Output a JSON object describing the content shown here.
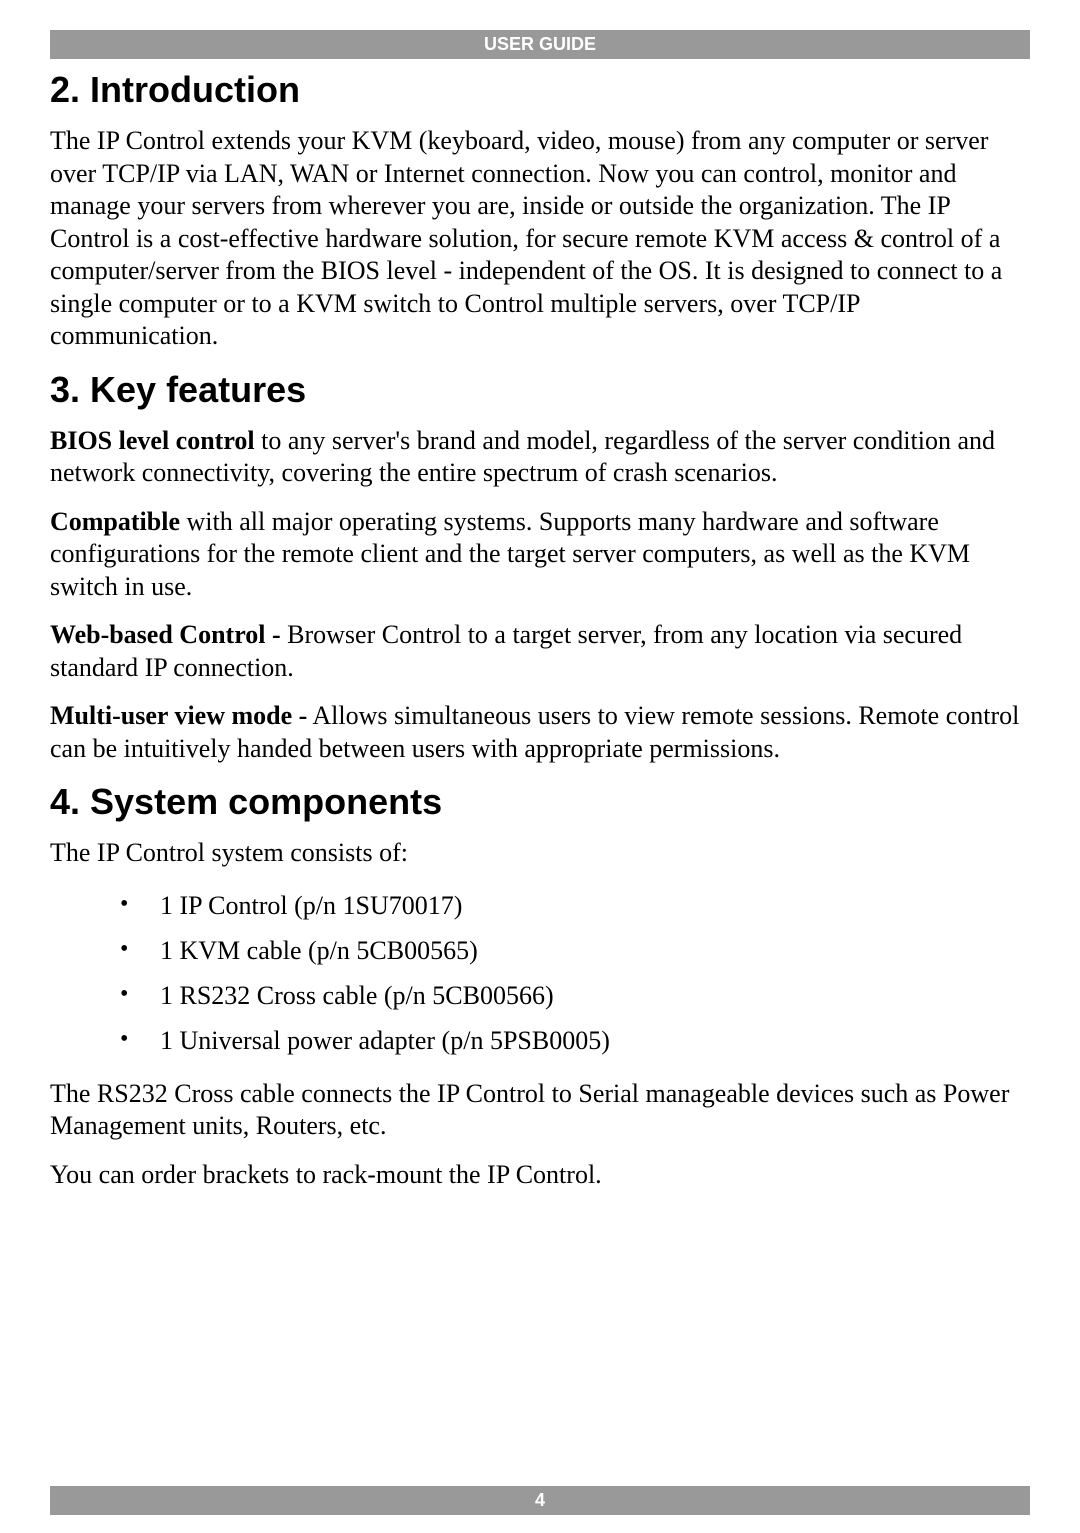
{
  "header": {
    "label": "USER GUIDE"
  },
  "sections": {
    "introduction": {
      "heading": "2. Introduction",
      "body": "The IP Control extends your KVM (keyboard, video, mouse) from any computer or server over TCP/IP via LAN, WAN or Internet connection. Now you can control, monitor and manage your servers from wherever you are, inside or outside the organization. The IP Control is a cost-effective hardware solution, for secure remote KVM access & control of a computer/server from the BIOS level - independent of the OS. It is designed to connect to a single computer or to a KVM switch to Control multiple servers, over TCP/IP communication."
    },
    "key_features": {
      "heading": "3. Key features",
      "features": [
        {
          "lead": "BIOS level control",
          "rest": " to any server's brand and model, regardless of the server condition and network connectivity, covering the entire spectrum of crash scenarios."
        },
        {
          "lead": "Compatible",
          "rest": " with all major operating systems. Supports many hardware and software configurations for the remote client and the target server computers, as well as the KVM switch in use."
        },
        {
          "lead": "Web-based Control -",
          "rest": " Browser Control to a target server, from any location via secured standard IP connection."
        },
        {
          "lead": "Multi-user view mode -",
          "rest": " Allows simultaneous users to view remote sessions. Remote control can be intuitively handed between users with appropriate permissions."
        }
      ]
    },
    "system_components": {
      "heading": "4. System components",
      "intro": "The IP Control system consists of:",
      "items": [
        "1 IP Control (p/n 1SU70017)",
        "1 KVM cable (p/n 5CB00565)",
        "1 RS232 Cross cable (p/n 5CB00566)",
        "1 Universal power adapter (p/n 5PSB0005)"
      ],
      "after1": "The RS232 Cross cable connects the IP Control to Serial manageable devices such as Power Management units, Routers, etc.",
      "after2": "You can order brackets to rack-mount the IP Control."
    }
  },
  "footer": {
    "page_number": "4"
  }
}
